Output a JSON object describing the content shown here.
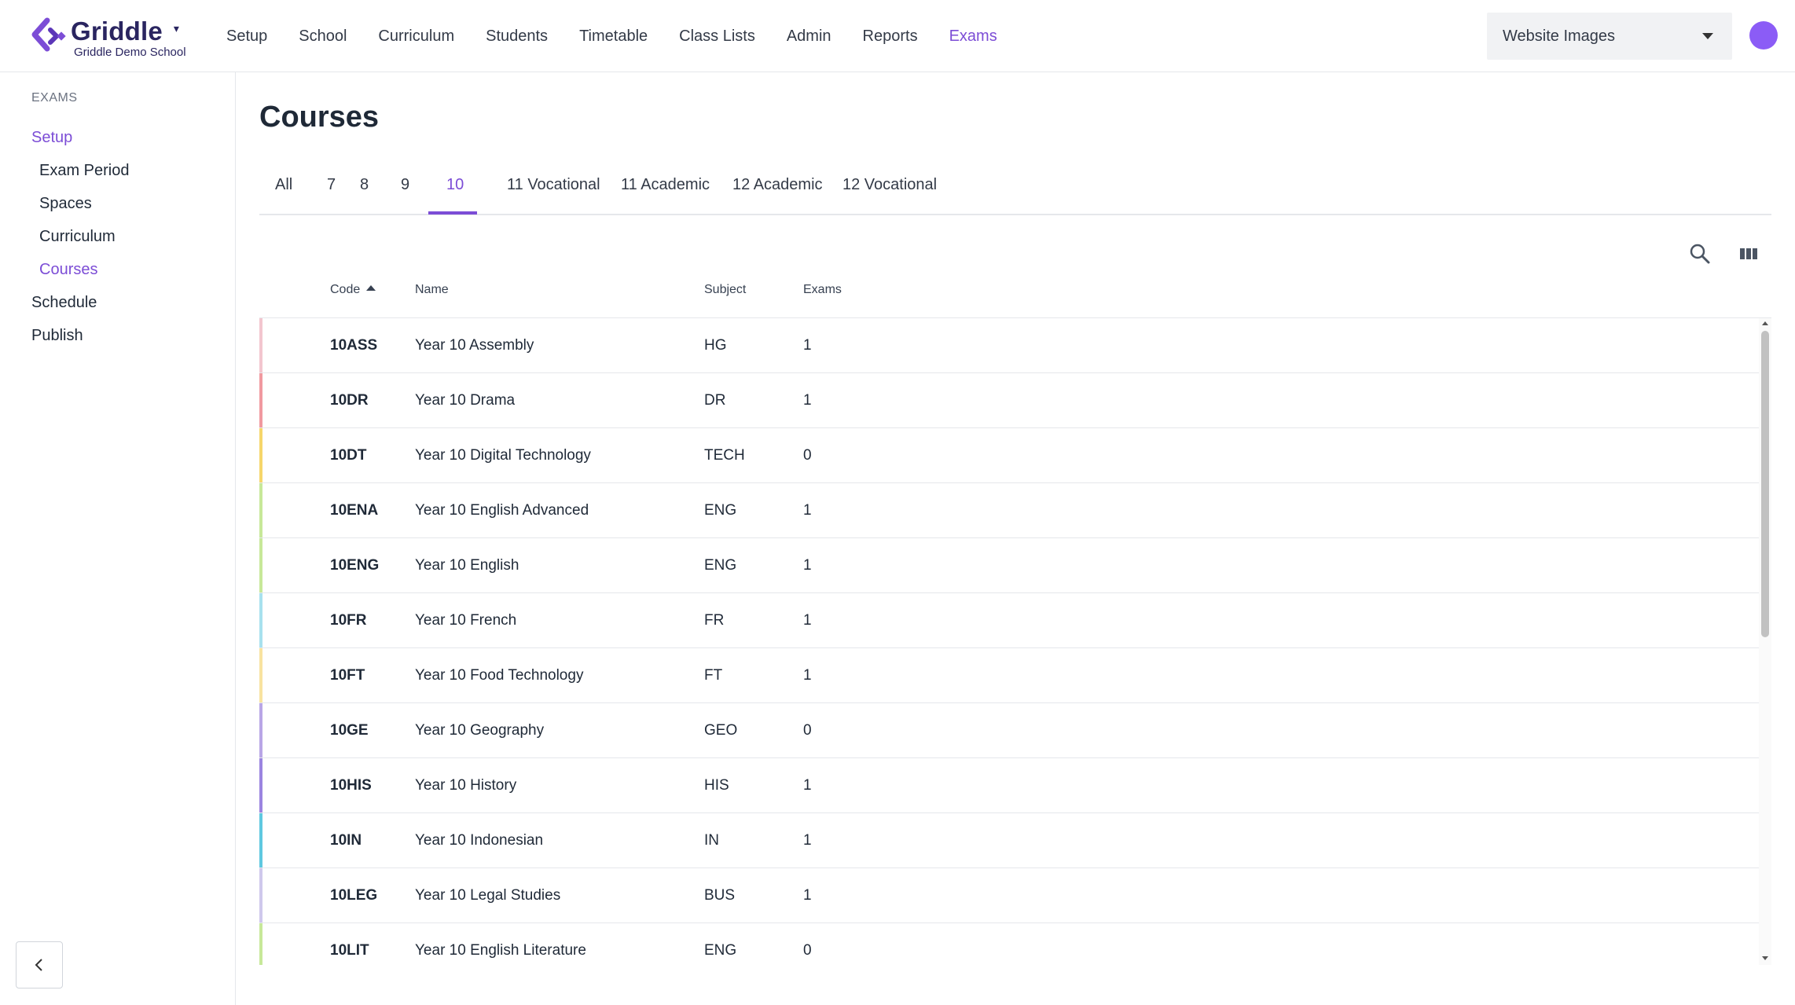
{
  "header": {
    "brand": "Griddle",
    "school": "Griddle Demo School",
    "nav": [
      {
        "label": "Setup",
        "active": false
      },
      {
        "label": "School",
        "active": false
      },
      {
        "label": "Curriculum",
        "active": false
      },
      {
        "label": "Students",
        "active": false
      },
      {
        "label": "Timetable",
        "active": false
      },
      {
        "label": "Class Lists",
        "active": false
      },
      {
        "label": "Admin",
        "active": false
      },
      {
        "label": "Reports",
        "active": false
      },
      {
        "label": "Exams",
        "active": true
      }
    ],
    "site_select": "Website Images"
  },
  "sidebar": {
    "section": "EXAMS",
    "items": [
      {
        "label": "Setup",
        "active": true
      },
      {
        "label": "Exam Period",
        "active": false
      },
      {
        "label": "Spaces",
        "active": false
      },
      {
        "label": "Curriculum",
        "active": false
      },
      {
        "label": "Courses",
        "active": true
      },
      {
        "label": "Schedule",
        "active": false
      },
      {
        "label": "Publish",
        "active": false
      }
    ]
  },
  "main": {
    "title": "Courses",
    "tabs": [
      {
        "label": "All",
        "active": false
      },
      {
        "label": "7",
        "active": false
      },
      {
        "label": "8",
        "active": false
      },
      {
        "label": "9",
        "active": false
      },
      {
        "label": "10",
        "active": true
      },
      {
        "label": "11 Vocational",
        "active": false
      },
      {
        "label": "11 Academic",
        "active": false
      },
      {
        "label": "12 Academic",
        "active": false
      },
      {
        "label": "12 Vocational",
        "active": false
      }
    ],
    "columns": {
      "code": "Code",
      "name": "Name",
      "subject": "Subject",
      "exams": "Exams"
    },
    "sort": {
      "column": "code",
      "direction": "ascending"
    },
    "rows": [
      {
        "code": "10ASS",
        "name": "Year 10 Assembly",
        "subject": "HG",
        "exams": "1",
        "color": "#f3c6cf"
      },
      {
        "code": "10DR",
        "name": "Year 10 Drama",
        "subject": "DR",
        "exams": "1",
        "color": "#f19aa0"
      },
      {
        "code": "10DT",
        "name": "Year 10 Digital Technology",
        "subject": "TECH",
        "exams": "0",
        "color": "#f6d66b"
      },
      {
        "code": "10ENA",
        "name": "Year 10 English Advanced",
        "subject": "ENG",
        "exams": "1",
        "color": "#c7e89a"
      },
      {
        "code": "10ENG",
        "name": "Year 10 English",
        "subject": "ENG",
        "exams": "1",
        "color": "#c7e89a"
      },
      {
        "code": "10FR",
        "name": "Year 10 French",
        "subject": "FR",
        "exams": "1",
        "color": "#a8e1ee"
      },
      {
        "code": "10FT",
        "name": "Year 10 Food Technology",
        "subject": "FT",
        "exams": "1",
        "color": "#f8e3a0"
      },
      {
        "code": "10GE",
        "name": "Year 10 Geography",
        "subject": "GEO",
        "exams": "0",
        "color": "#b9a6e6"
      },
      {
        "code": "10HIS",
        "name": "Year 10 History",
        "subject": "HIS",
        "exams": "1",
        "color": "#9b84e0"
      },
      {
        "code": "10IN",
        "name": "Year 10 Indonesian",
        "subject": "IN",
        "exams": "1",
        "color": "#5fc8e0"
      },
      {
        "code": "10LEG",
        "name": "Year 10 Legal Studies",
        "subject": "BUS",
        "exams": "1",
        "color": "#cfc8ec"
      },
      {
        "code": "10LIT",
        "name": "Year 10 English Literature",
        "subject": "ENG",
        "exams": "0",
        "color": "#c7e89a"
      }
    ]
  },
  "icons": {
    "logo": "griddle-logo-icon",
    "search": "search-icon",
    "columns": "view-columns-icon",
    "collapse": "chevron-left-icon"
  },
  "colors": {
    "accent": "#7c4dd6",
    "avatar": "#8b5cf6",
    "brand_text": "#2a2560"
  }
}
